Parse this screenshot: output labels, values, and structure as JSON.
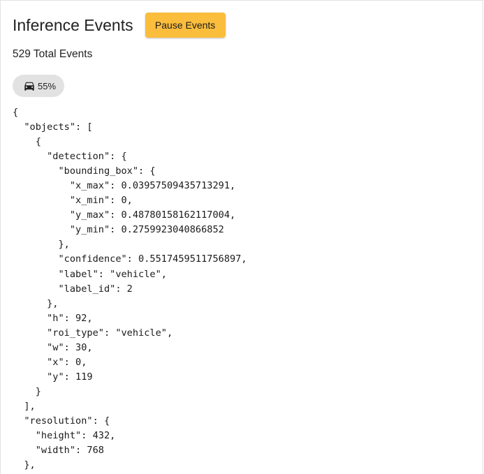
{
  "header": {
    "title": "Inference Events",
    "pause_label": "Pause Events"
  },
  "summary": {
    "total_events": "529 Total Events"
  },
  "chip": {
    "icon": "car-icon",
    "label": "55%"
  },
  "event_json": "{\n  \"objects\": [\n    {\n      \"detection\": {\n        \"bounding_box\": {\n          \"x_max\": 0.03957509435713291,\n          \"x_min\": 0,\n          \"y_max\": 0.48780158162117004,\n          \"y_min\": 0.2759923040866852\n        },\n        \"confidence\": 0.5517459511756897,\n        \"label\": \"vehicle\",\n        \"label_id\": 2\n      },\n      \"h\": 92,\n      \"roi_type\": \"vehicle\",\n      \"w\": 30,\n      \"x\": 0,\n      \"y\": 119\n    }\n  ],\n  \"resolution\": {\n    \"height\": 432,\n    \"width\": 768\n  },",
  "colors": {
    "accent": "#fbbd3c",
    "chip_background": "#e2e2e2"
  }
}
